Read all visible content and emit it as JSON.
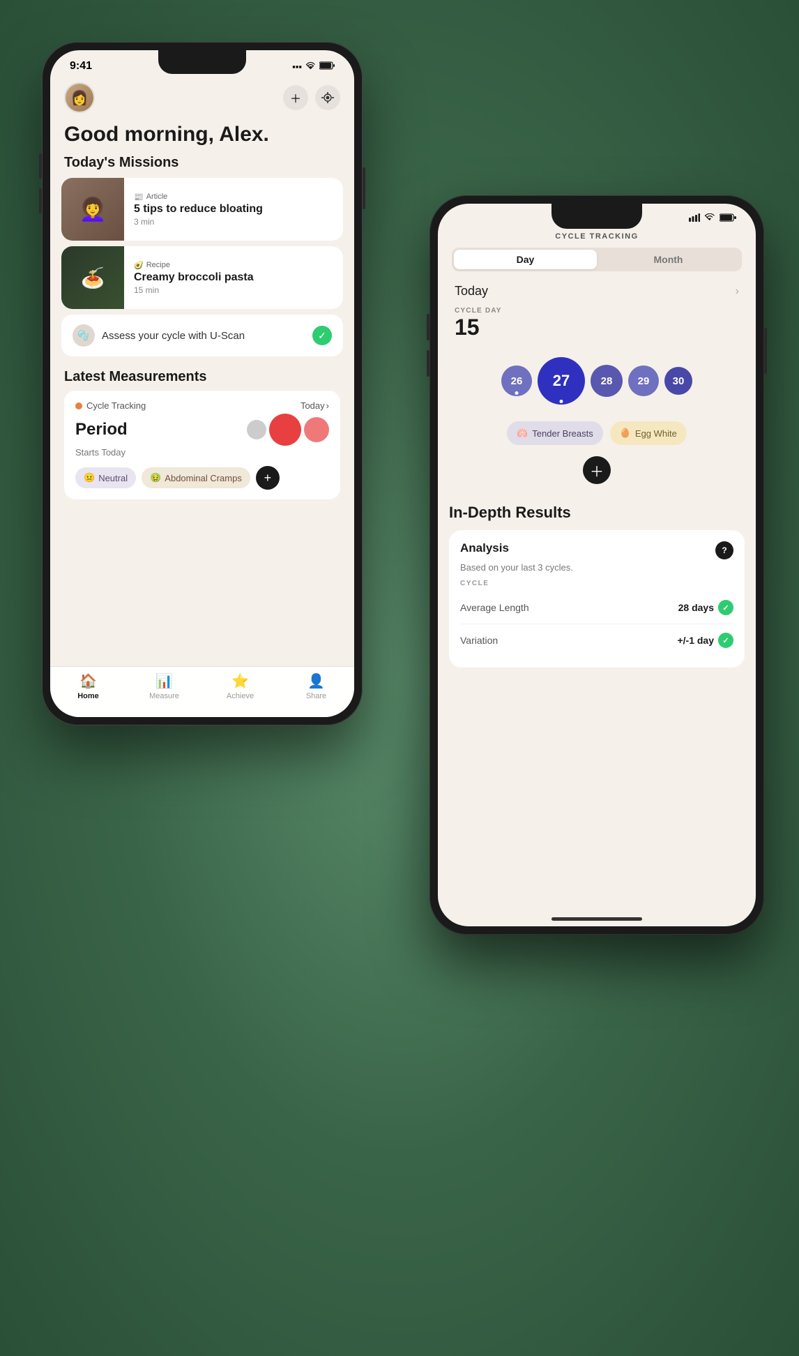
{
  "app": {
    "background_color": "#4a7c5a"
  },
  "phone1": {
    "status_bar": {
      "time": "9:41",
      "signal": "▪▪▪",
      "wifi": "wifi",
      "battery": "battery"
    },
    "greeting": "Good morning, Alex.",
    "sections": {
      "missions_title": "Today's Missions",
      "mission1": {
        "type": "Article",
        "title": "5 tips to reduce bloating",
        "duration": "3 min",
        "icon": "📰"
      },
      "mission2": {
        "type": "Recipe",
        "title": "Creamy broccoli pasta",
        "duration": "15 min",
        "icon": "🥑"
      },
      "uscan": {
        "label": "Assess your cycle with U-Scan",
        "completed": true
      },
      "measurements_title": "Latest Measurements",
      "measurement": {
        "tracker_label": "Cycle Tracking",
        "today_label": "Today",
        "period_title": "Period",
        "starts_today": "Starts Today"
      },
      "tags": [
        {
          "label": "Neutral",
          "icon": "😐",
          "style": "neutral"
        },
        {
          "label": "Abdominal Cramps",
          "icon": "🤢",
          "style": "cramps"
        }
      ],
      "add_tag_label": "+"
    },
    "tab_bar": {
      "tabs": [
        {
          "label": "Home",
          "icon": "🏠",
          "active": true
        },
        {
          "label": "Measure",
          "icon": "📊",
          "active": false
        },
        {
          "label": "Achieve",
          "icon": "⭐",
          "active": false
        },
        {
          "label": "Share",
          "icon": "👤",
          "active": false
        }
      ]
    }
  },
  "phone2": {
    "status_bar": {
      "signal": "▪▪▪",
      "wifi": "wifi",
      "battery": "battery"
    },
    "nav_title": "CYCLE TRACKING",
    "tabs": [
      {
        "label": "Day",
        "active": true
      },
      {
        "label": "Month",
        "active": false
      }
    ],
    "today_label": "Today",
    "cycle_day_label": "CYCLE DAY",
    "cycle_day_num": "15",
    "calendar_days": [
      {
        "num": "26",
        "size": "sm",
        "has_dot": true
      },
      {
        "num": "27",
        "size": "lg",
        "has_dot": true
      },
      {
        "num": "28",
        "size": "sm2",
        "has_dot": false
      },
      {
        "num": "29",
        "size": "sm",
        "has_dot": false
      },
      {
        "num": "30",
        "size": "sm3",
        "has_dot": false
      }
    ],
    "symptoms": [
      {
        "label": "Tender Breasts",
        "icon": "🫁",
        "style": "breasts"
      },
      {
        "label": "Egg White",
        "icon": "🥚",
        "style": "egg"
      }
    ],
    "in_depth_title": "In-Depth Results",
    "analysis_card": {
      "title": "Analysis",
      "subtitle": "Based on your last 3 cycles.",
      "cycle_label": "CYCLE",
      "stats": [
        {
          "label": "Average Length",
          "value": "28 days",
          "check": true
        },
        {
          "label": "Variation",
          "value": "+/-1 day",
          "check": true
        }
      ]
    }
  }
}
